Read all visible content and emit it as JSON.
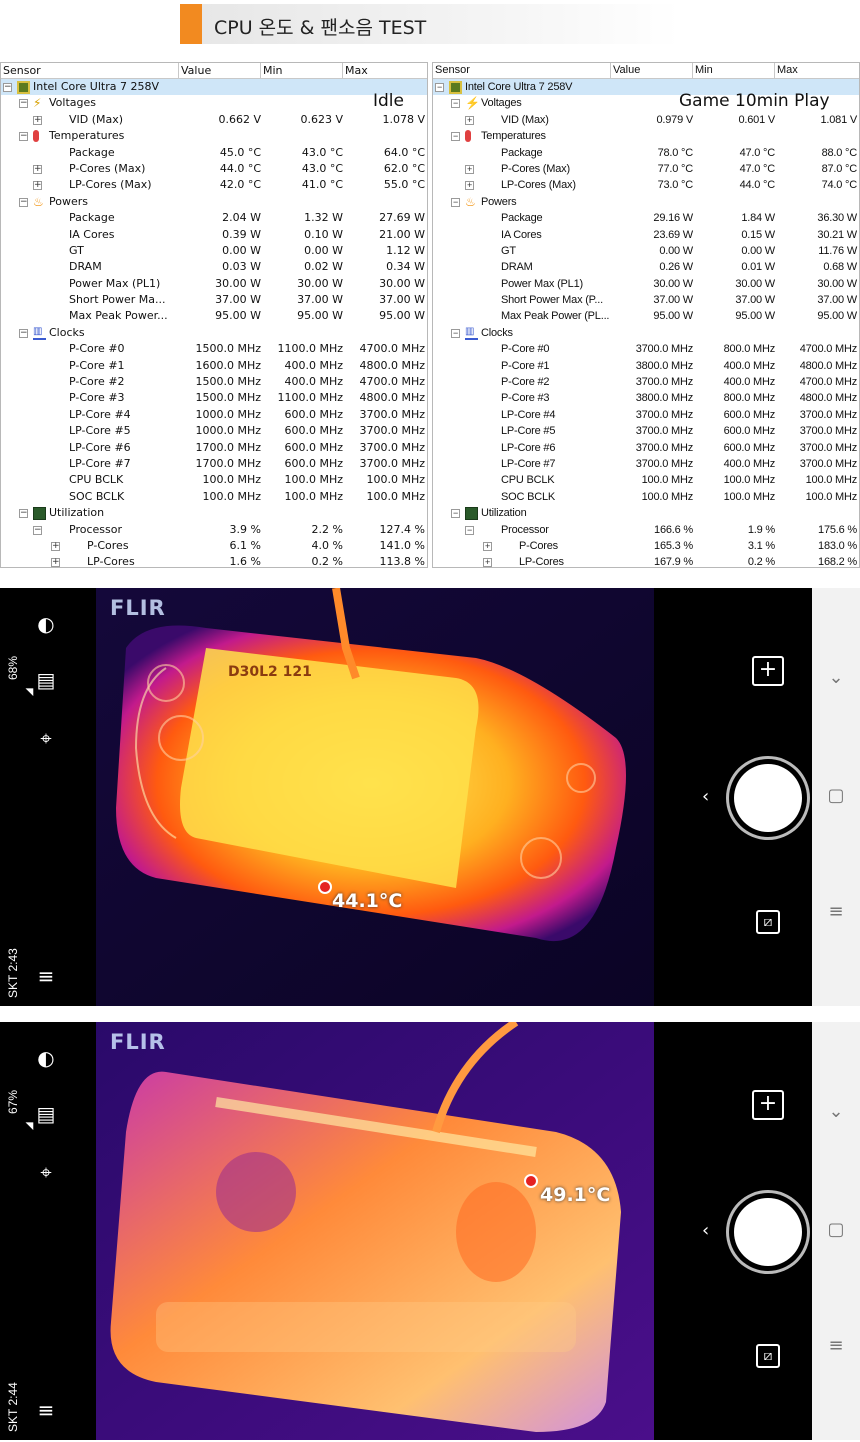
{
  "title": "CPU 온도 & 팬소음 TEST",
  "headers": [
    "Sensor",
    "Value",
    "Min",
    "Max"
  ],
  "idle": {
    "label": "Idle",
    "rows": [
      {
        "n": "Intel Core Ultra 7 258V",
        "lvl": 0,
        "icon": "chip",
        "exp": "-",
        "sel": true
      },
      {
        "n": "Voltages",
        "lvl": 1,
        "icon": "volt",
        "exp": "-"
      },
      {
        "n": "VID (Max)",
        "lvl": 2,
        "exp": "+",
        "v": "0.662 V",
        "mn": "0.623 V",
        "mx": "1.078 V"
      },
      {
        "n": "Temperatures",
        "lvl": 1,
        "icon": "temp",
        "exp": "-"
      },
      {
        "n": "Package",
        "lvl": 2,
        "v": "45.0 °C",
        "mn": "43.0 °C",
        "mx": "64.0 °C"
      },
      {
        "n": "P-Cores (Max)",
        "lvl": 2,
        "exp": "+",
        "v": "44.0 °C",
        "mn": "43.0 °C",
        "mx": "62.0 °C"
      },
      {
        "n": "LP-Cores (Max)",
        "lvl": 2,
        "exp": "+",
        "v": "42.0 °C",
        "mn": "41.0 °C",
        "mx": "55.0 °C"
      },
      {
        "n": "Powers",
        "lvl": 1,
        "icon": "pow",
        "exp": "-"
      },
      {
        "n": "Package",
        "lvl": 2,
        "v": "2.04 W",
        "mn": "1.32 W",
        "mx": "27.69 W"
      },
      {
        "n": "IA Cores",
        "lvl": 2,
        "v": "0.39 W",
        "mn": "0.10 W",
        "mx": "21.00 W"
      },
      {
        "n": "GT",
        "lvl": 2,
        "v": "0.00 W",
        "mn": "0.00 W",
        "mx": "1.12 W"
      },
      {
        "n": "DRAM",
        "lvl": 2,
        "v": "0.03 W",
        "mn": "0.02 W",
        "mx": "0.34 W"
      },
      {
        "n": "Power Max (PL1)",
        "lvl": 2,
        "v": "30.00 W",
        "mn": "30.00 W",
        "mx": "30.00 W"
      },
      {
        "n": "Short Power Ma...",
        "lvl": 2,
        "v": "37.00 W",
        "mn": "37.00 W",
        "mx": "37.00 W"
      },
      {
        "n": "Max Peak Power...",
        "lvl": 2,
        "v": "95.00 W",
        "mn": "95.00 W",
        "mx": "95.00 W"
      },
      {
        "n": "Clocks",
        "lvl": 1,
        "icon": "clk",
        "exp": "-"
      },
      {
        "n": "P-Core #0",
        "lvl": 2,
        "v": "1500.0 MHz",
        "mn": "1100.0 MHz",
        "mx": "4700.0 MHz"
      },
      {
        "n": "P-Core #1",
        "lvl": 2,
        "v": "1600.0 MHz",
        "mn": "400.0 MHz",
        "mx": "4800.0 MHz"
      },
      {
        "n": "P-Core #2",
        "lvl": 2,
        "v": "1500.0 MHz",
        "mn": "400.0 MHz",
        "mx": "4700.0 MHz"
      },
      {
        "n": "P-Core #3",
        "lvl": 2,
        "v": "1500.0 MHz",
        "mn": "1100.0 MHz",
        "mx": "4800.0 MHz"
      },
      {
        "n": "LP-Core #4",
        "lvl": 2,
        "v": "1000.0 MHz",
        "mn": "600.0 MHz",
        "mx": "3700.0 MHz"
      },
      {
        "n": "LP-Core #5",
        "lvl": 2,
        "v": "1000.0 MHz",
        "mn": "600.0 MHz",
        "mx": "3700.0 MHz"
      },
      {
        "n": "LP-Core #6",
        "lvl": 2,
        "v": "1700.0 MHz",
        "mn": "600.0 MHz",
        "mx": "3700.0 MHz"
      },
      {
        "n": "LP-Core #7",
        "lvl": 2,
        "v": "1700.0 MHz",
        "mn": "600.0 MHz",
        "mx": "3700.0 MHz"
      },
      {
        "n": "CPU BCLK",
        "lvl": 2,
        "v": "100.0 MHz",
        "mn": "100.0 MHz",
        "mx": "100.0 MHz"
      },
      {
        "n": "SOC BCLK",
        "lvl": 2,
        "v": "100.0 MHz",
        "mn": "100.0 MHz",
        "mx": "100.0 MHz"
      },
      {
        "n": "Utilization",
        "lvl": 1,
        "icon": "util",
        "exp": "-"
      },
      {
        "n": "Processor",
        "lvl": 2,
        "exp": "-",
        "v": "3.9 %",
        "mn": "2.2 %",
        "mx": "127.4 %"
      },
      {
        "n": "P-Cores",
        "lvl": 3,
        "exp": "+",
        "v": "6.1 %",
        "mn": "4.0 %",
        "mx": "141.0 %"
      },
      {
        "n": "LP-Cores",
        "lvl": 3,
        "exp": "+",
        "v": "1.6 %",
        "mn": "0.2 %",
        "mx": "113.8 %"
      }
    ]
  },
  "game": {
    "label": "Game 10min Play",
    "rows": [
      {
        "n": "Intel Core Ultra 7 258V",
        "lvl": 0,
        "icon": "chip",
        "exp": "-",
        "sel": true
      },
      {
        "n": "Voltages",
        "lvl": 1,
        "icon": "volt",
        "exp": "-"
      },
      {
        "n": "VID (Max)",
        "lvl": 2,
        "exp": "+",
        "v": "0.979 V",
        "mn": "0.601 V",
        "mx": "1.081 V"
      },
      {
        "n": "Temperatures",
        "lvl": 1,
        "icon": "temp",
        "exp": "-"
      },
      {
        "n": "Package",
        "lvl": 2,
        "v": "78.0 °C",
        "mn": "47.0 °C",
        "mx": "88.0 °C"
      },
      {
        "n": "P-Cores (Max)",
        "lvl": 2,
        "exp": "+",
        "v": "77.0 °C",
        "mn": "47.0 °C",
        "mx": "87.0 °C"
      },
      {
        "n": "LP-Cores (Max)",
        "lvl": 2,
        "exp": "+",
        "v": "73.0 °C",
        "mn": "44.0 °C",
        "mx": "74.0 °C"
      },
      {
        "n": "Powers",
        "lvl": 1,
        "icon": "pow",
        "exp": "-"
      },
      {
        "n": "Package",
        "lvl": 2,
        "v": "29.16 W",
        "mn": "1.84 W",
        "mx": "36.30 W"
      },
      {
        "n": "IA Cores",
        "lvl": 2,
        "v": "23.69 W",
        "mn": "0.15 W",
        "mx": "30.21 W"
      },
      {
        "n": "GT",
        "lvl": 2,
        "v": "0.00 W",
        "mn": "0.00 W",
        "mx": "11.76 W"
      },
      {
        "n": "DRAM",
        "lvl": 2,
        "v": "0.26 W",
        "mn": "0.01 W",
        "mx": "0.68 W"
      },
      {
        "n": "Power Max (PL1)",
        "lvl": 2,
        "v": "30.00 W",
        "mn": "30.00 W",
        "mx": "30.00 W"
      },
      {
        "n": "Short Power Max (P...",
        "lvl": 2,
        "v": "37.00 W",
        "mn": "37.00 W",
        "mx": "37.00 W"
      },
      {
        "n": "Max Peak Power (PL...",
        "lvl": 2,
        "v": "95.00 W",
        "mn": "95.00 W",
        "mx": "95.00 W"
      },
      {
        "n": "Clocks",
        "lvl": 1,
        "icon": "clk",
        "exp": "-"
      },
      {
        "n": "P-Core #0",
        "lvl": 2,
        "v": "3700.0 MHz",
        "mn": "800.0 MHz",
        "mx": "4700.0 MHz"
      },
      {
        "n": "P-Core #1",
        "lvl": 2,
        "v": "3800.0 MHz",
        "mn": "400.0 MHz",
        "mx": "4800.0 MHz"
      },
      {
        "n": "P-Core #2",
        "lvl": 2,
        "v": "3700.0 MHz",
        "mn": "400.0 MHz",
        "mx": "4700.0 MHz"
      },
      {
        "n": "P-Core #3",
        "lvl": 2,
        "v": "3800.0 MHz",
        "mn": "800.0 MHz",
        "mx": "4800.0 MHz"
      },
      {
        "n": "LP-Core #4",
        "lvl": 2,
        "v": "3700.0 MHz",
        "mn": "600.0 MHz",
        "mx": "3700.0 MHz"
      },
      {
        "n": "LP-Core #5",
        "lvl": 2,
        "v": "3700.0 MHz",
        "mn": "600.0 MHz",
        "mx": "3700.0 MHz"
      },
      {
        "n": "LP-Core #6",
        "lvl": 2,
        "v": "3700.0 MHz",
        "mn": "600.0 MHz",
        "mx": "3700.0 MHz"
      },
      {
        "n": "LP-Core #7",
        "lvl": 2,
        "v": "3700.0 MHz",
        "mn": "400.0 MHz",
        "mx": "3700.0 MHz"
      },
      {
        "n": "CPU BCLK",
        "lvl": 2,
        "v": "100.0 MHz",
        "mn": "100.0 MHz",
        "mx": "100.0 MHz"
      },
      {
        "n": "SOC BCLK",
        "lvl": 2,
        "v": "100.0 MHz",
        "mn": "100.0 MHz",
        "mx": "100.0 MHz"
      },
      {
        "n": "Utilization",
        "lvl": 1,
        "icon": "util",
        "exp": "-"
      },
      {
        "n": "Processor",
        "lvl": 2,
        "exp": "-",
        "v": "166.6 %",
        "mn": "1.9 %",
        "mx": "175.6 %"
      },
      {
        "n": "P-Cores",
        "lvl": 3,
        "exp": "+",
        "v": "165.3 %",
        "mn": "3.1 %",
        "mx": "183.0 %"
      },
      {
        "n": "LP-Cores",
        "lvl": 3,
        "exp": "+",
        "v": "167.9 %",
        "mn": "0.2 %",
        "mx": "168.2 %"
      }
    ]
  },
  "flir1": {
    "logo": "FLIR",
    "temp": "44.1°C",
    "battery": "68%",
    "status": "SKT 2:43"
  },
  "flir2": {
    "logo": "FLIR",
    "temp": "49.1°C",
    "battery": "67%",
    "status": "SKT 2:44"
  },
  "icons": {
    "left_bar": [
      "contrast-icon",
      "ruler-icon",
      "crosshair-icon",
      "menu-icon"
    ],
    "right_bar": [
      "plus-icon",
      "shutter-button",
      "back-icon",
      "gallery-icon"
    ],
    "nav": [
      "chevron-down-icon",
      "home-icon",
      "recents-icon"
    ]
  },
  "colors": {
    "accent": "#f28a20",
    "selected_row": "#cfe6f8",
    "spot": "#e52222"
  }
}
